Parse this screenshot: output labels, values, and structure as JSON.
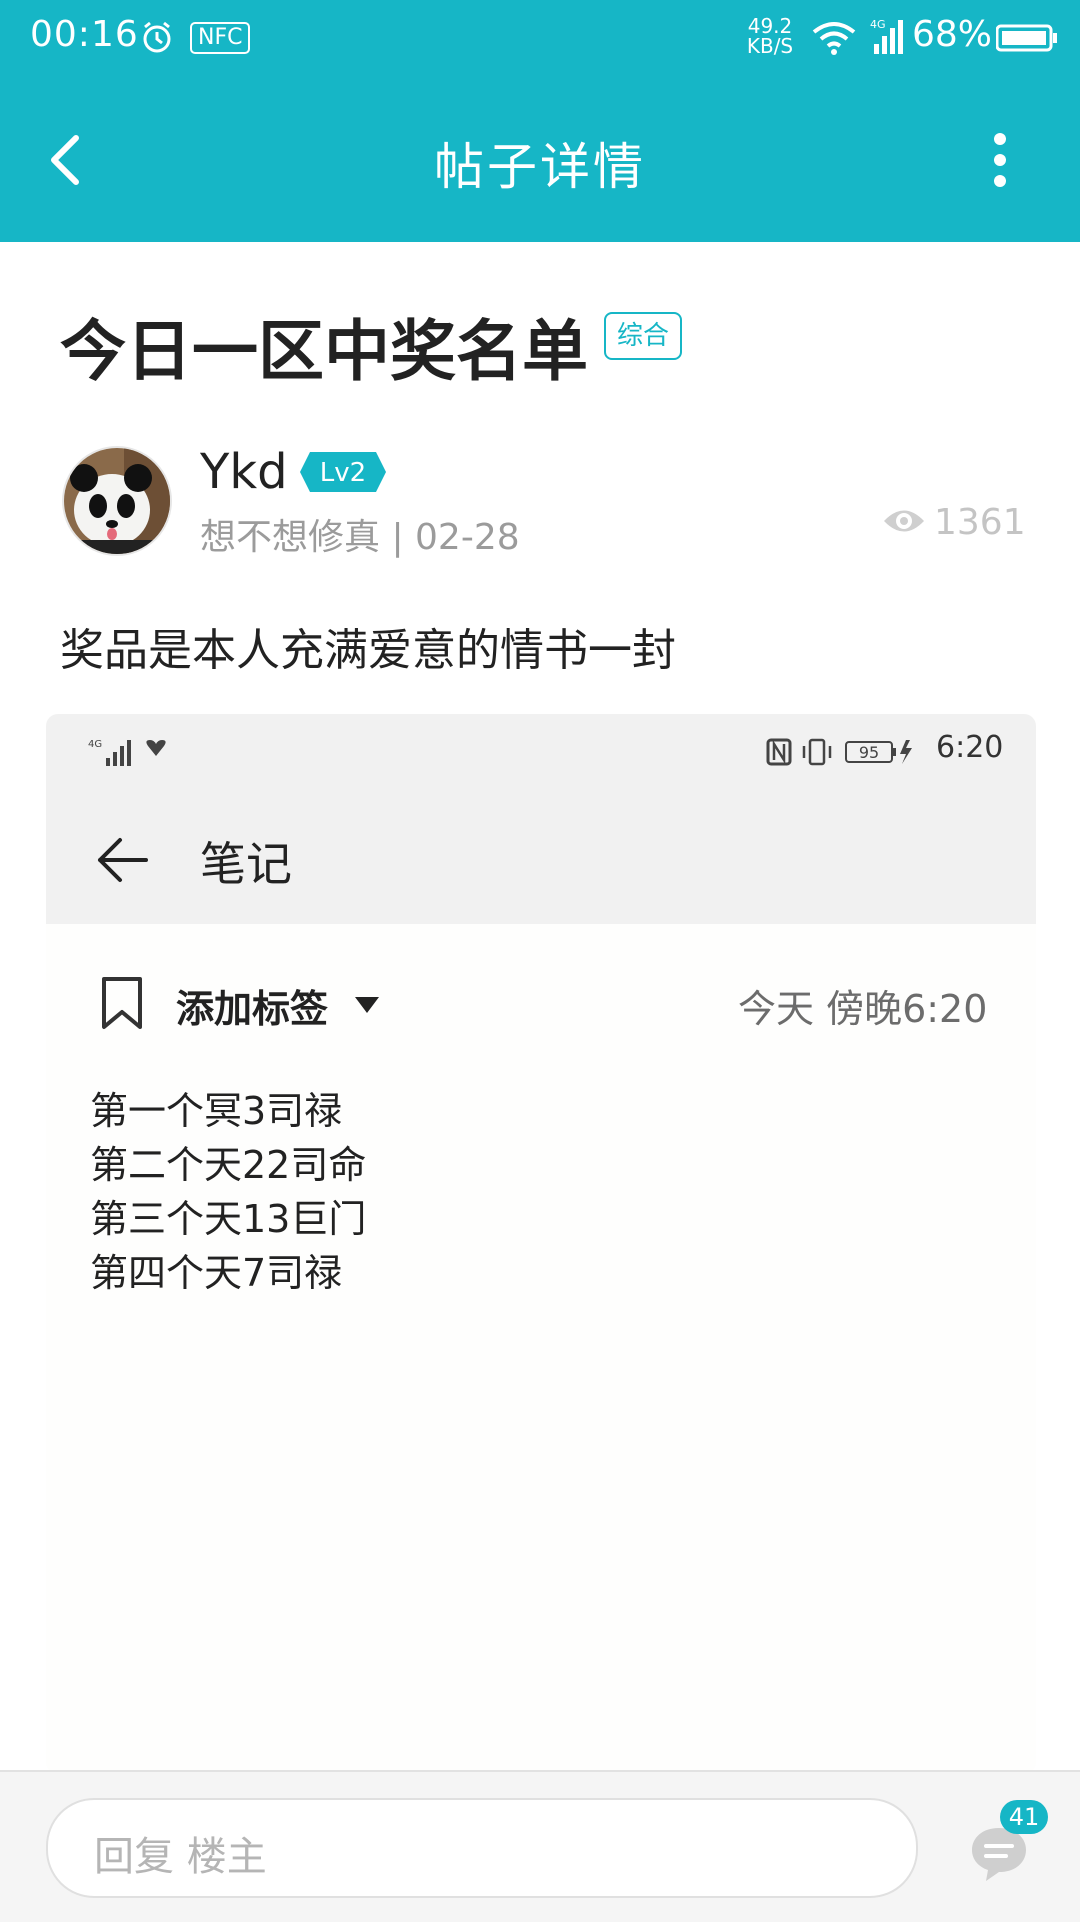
{
  "status_bar": {
    "time": "00:16",
    "nfc_label": "NFC",
    "net_speed_value": "49.2",
    "net_speed_unit": "KB/S",
    "battery_percent": "68%"
  },
  "app_bar": {
    "title": "帖子详情",
    "back_icon": "chevron-left-icon",
    "more_icon": "more-vertical-icon"
  },
  "post": {
    "title": "今日一区中奖名单",
    "tag": "综合",
    "author": {
      "name": "Ykd",
      "level": "Lv2",
      "meta": "想不想修真 | 02-28"
    },
    "view_count": "1361",
    "body": "奖品是本人充满爱意的情书一封"
  },
  "embedded_screenshot": {
    "status_time": "6:20",
    "battery_level": "95",
    "title": "笔记",
    "add_tag_label": "添加标签",
    "datetime": "今天 傍晚6:20",
    "note_lines": [
      "第一个冥3司禄",
      "第二个天22司命",
      "第三个天13巨门",
      "第四个天7司禄"
    ]
  },
  "bottom_bar": {
    "reply_placeholder": "回复  楼主",
    "comment_count": "41"
  },
  "colors": {
    "accent": "#16b6c6",
    "text_primary": "#222222",
    "text_secondary": "#9b9b9b"
  }
}
